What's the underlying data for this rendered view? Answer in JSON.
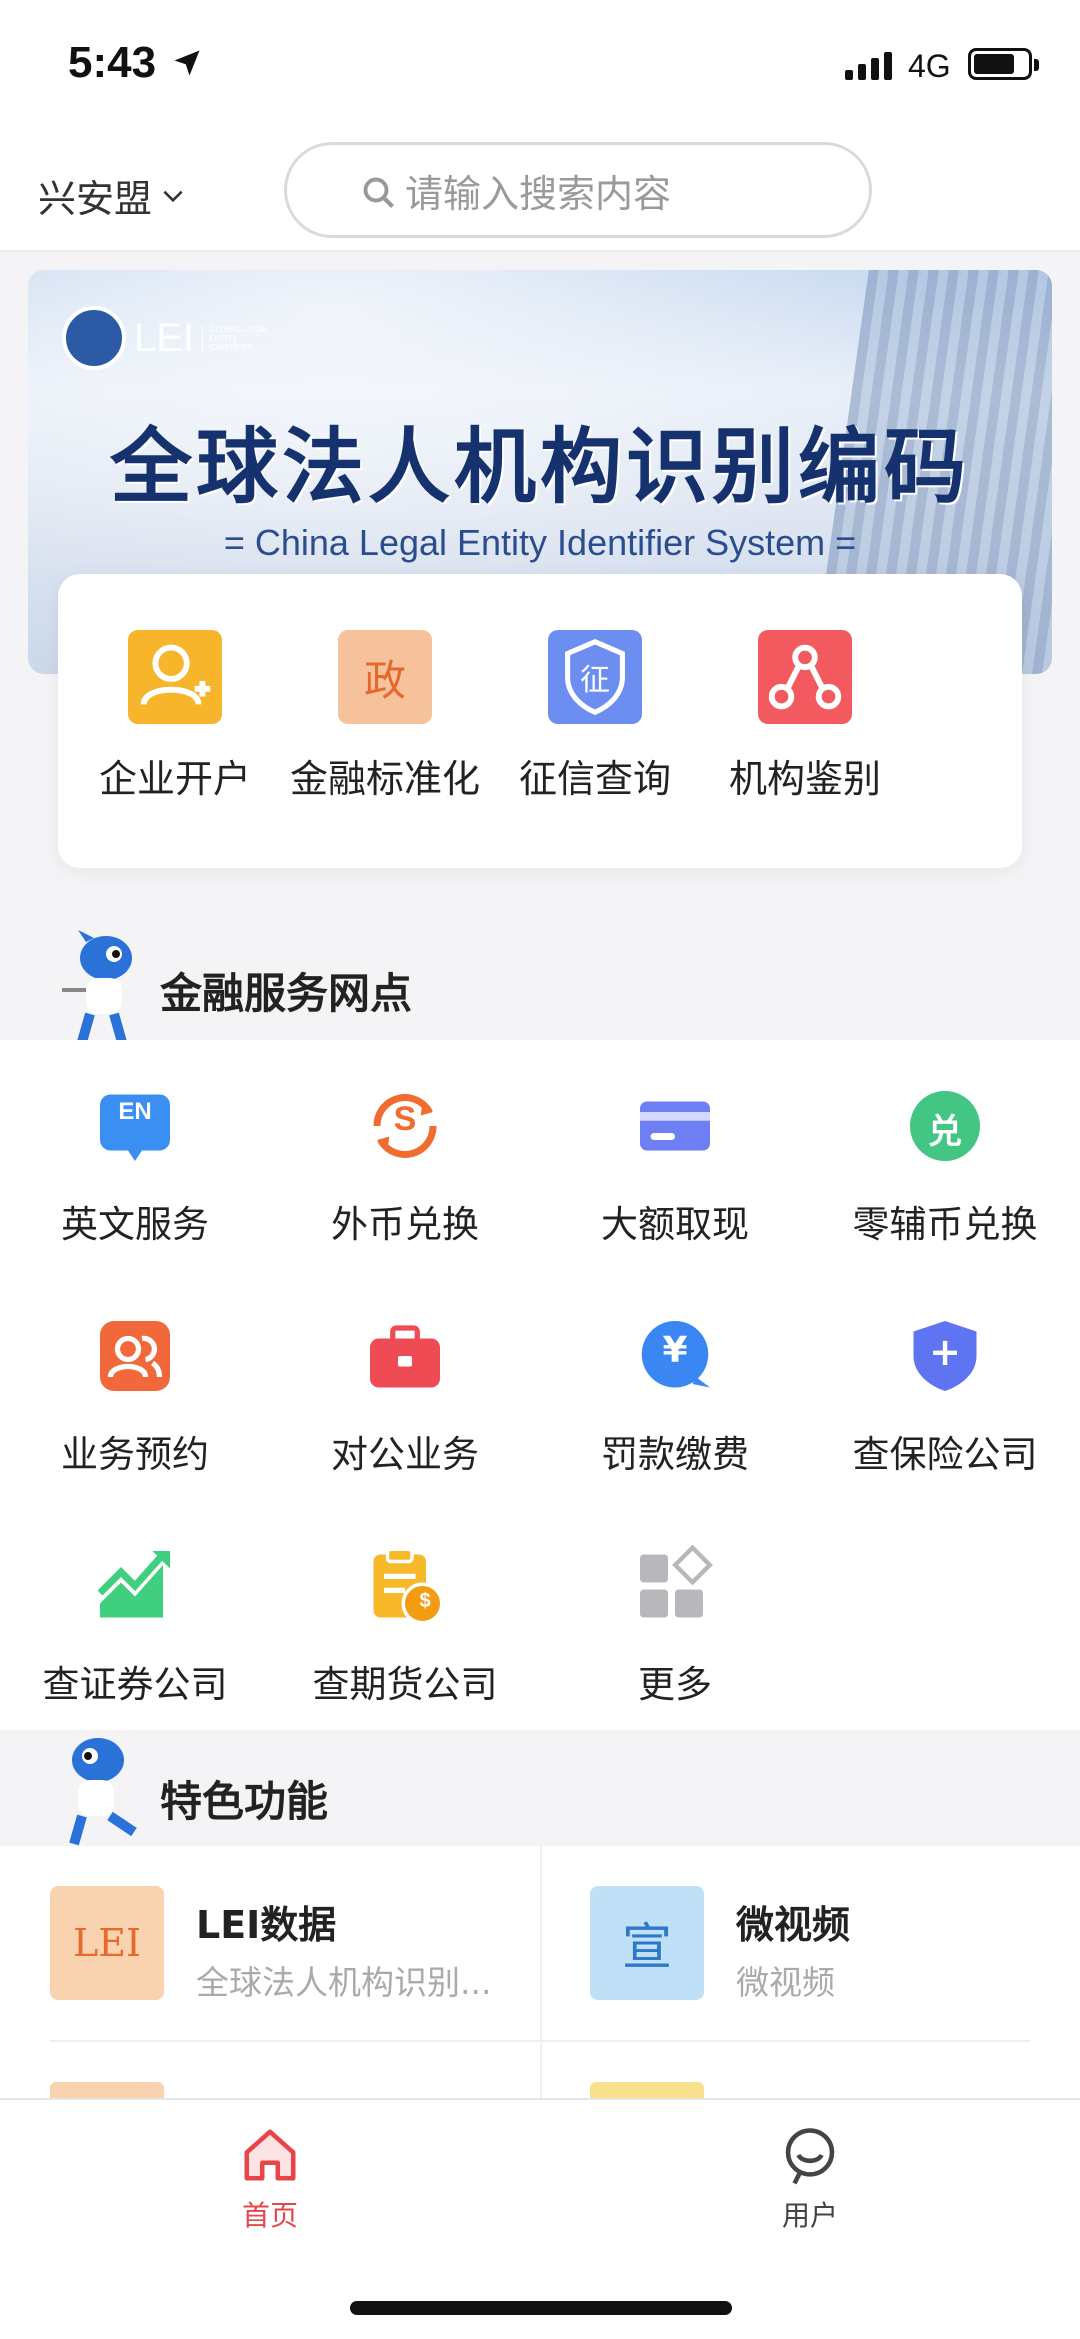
{
  "status_bar": {
    "time": "5:43",
    "network": "4G"
  },
  "header": {
    "region": "兴安盟",
    "search_placeholder": "请输入搜索内容"
  },
  "banner": {
    "logo_text": "LEI",
    "logo_subtext": "GLOBAL LEGAL ENTITY IDENTIFIER",
    "title": "全球法人机构识别编码",
    "subtitle": "= China Legal Entity Identifier System ="
  },
  "quick_actions": [
    {
      "label": "企业开户",
      "icon": "person-add-icon",
      "color": "#f7b52c"
    },
    {
      "label": "金融标准化",
      "icon": "zheng-seal-icon",
      "color": "#f6c29b",
      "glyph": "政"
    },
    {
      "label": "征信查询",
      "icon": "credit-shield-icon",
      "color": "#6c8ef0",
      "glyph": "征"
    },
    {
      "label": "机构鉴别",
      "icon": "share-nodes-icon",
      "color": "#f35a5f"
    }
  ],
  "section_services": {
    "title": "金融服务网点"
  },
  "services": [
    {
      "label": "英文服务",
      "icon": "en-icon",
      "color": "#3b8ff3",
      "glyph": "EN"
    },
    {
      "label": "外币兑换",
      "icon": "currency-exchange-icon",
      "color": "#f26b2f",
      "glyph": "S"
    },
    {
      "label": "大额取现",
      "icon": "card-icon",
      "color": "#6e7ef4"
    },
    {
      "label": "零辅币兑换",
      "icon": "exchange-badge-icon",
      "color": "#43c683",
      "glyph": "兑"
    },
    {
      "label": "业务预约",
      "icon": "people-icon",
      "color": "#f1683b"
    },
    {
      "label": "对公业务",
      "icon": "briefcase-icon",
      "color": "#ef4b55"
    },
    {
      "label": "罚款缴费",
      "icon": "yuan-bubble-icon",
      "color": "#3a86f2",
      "glyph": "¥"
    },
    {
      "label": "查保险公司",
      "icon": "insurance-shield-icon",
      "color": "#5e74f0",
      "glyph": "+"
    },
    {
      "label": "查证券公司",
      "icon": "stock-trend-icon",
      "color": "#3fcf7f"
    },
    {
      "label": "查期货公司",
      "icon": "clipboard-coin-icon",
      "color": "#f7b92a",
      "glyph": "$"
    },
    {
      "label": "更多",
      "icon": "more-grid-icon",
      "color": "#b8b8bc"
    }
  ],
  "section_features": {
    "title": "特色功能"
  },
  "features": [
    {
      "title": "LEI数据",
      "subtitle": "全球法人机构识别...",
      "thumb_text": "LEI",
      "thumb_color": "#f9d3b0"
    },
    {
      "title": "微视频",
      "subtitle": "微视频",
      "thumb_text": "宣",
      "thumb_color": "#bfe0f7"
    }
  ],
  "tabbar": {
    "tabs": [
      {
        "label": "首页",
        "icon": "home-icon",
        "active": true
      },
      {
        "label": "用户",
        "icon": "user-smile-icon",
        "active": false
      }
    ],
    "active_color": "#e8454b"
  }
}
